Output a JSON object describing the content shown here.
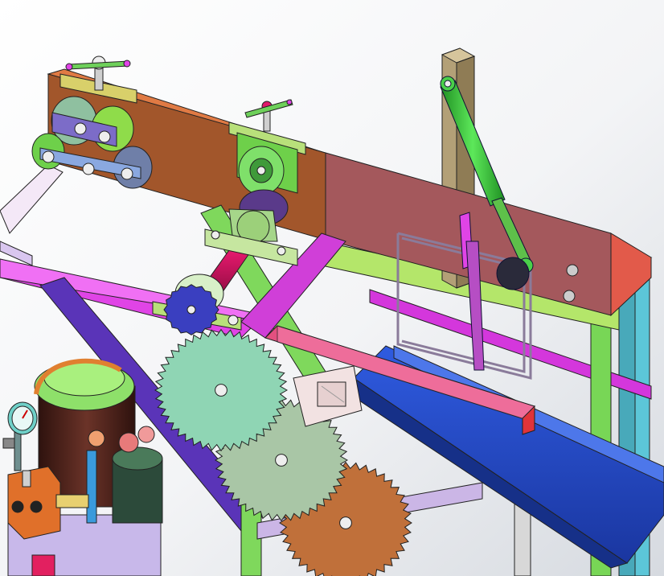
{
  "scene": {
    "description_text": "",
    "colors": {
      "background_top": "#ffffff",
      "background_bottom": "#d9dde3",
      "plate_orange": "#a2562b",
      "plate_red": "#a4585c",
      "frame_magenta": "#e044e6",
      "frame_green": "#7fd85c",
      "frame_violet": "#5a34b8",
      "frame_cyan": "#5cc6d8",
      "cylinder_green": "#39c23b",
      "shaft_pink": "#e0186a",
      "gear_mint": "#8fd5b4",
      "gear_sage": "#a9c6a6",
      "gear_copper": "#c0703a",
      "gear_navy": "#3a3fc0",
      "chute_blue": "#2147c8",
      "pump_orange": "#e0702a",
      "tank_brown": "#5a2a22",
      "tank_cap_green": "#8ee06a",
      "gauge_teal": "#6fd0c8",
      "motor_green": "#b8e07a",
      "post_tan": "#b3a077"
    },
    "components": [
      "hand-crank-handle-left",
      "hand-crank-handle-middle",
      "roller-cluster-left",
      "roller-assembly-middle",
      "main-plate",
      "vertical-post",
      "hydraulic-cylinder",
      "pink-shaft",
      "navy-pinion-gear",
      "mint-gear",
      "sage-gear",
      "copper-gear",
      "blue-chute",
      "hydraulic-tank",
      "pressure-gauge",
      "pump-block",
      "motor-unit",
      "wire-frame-guard"
    ]
  }
}
